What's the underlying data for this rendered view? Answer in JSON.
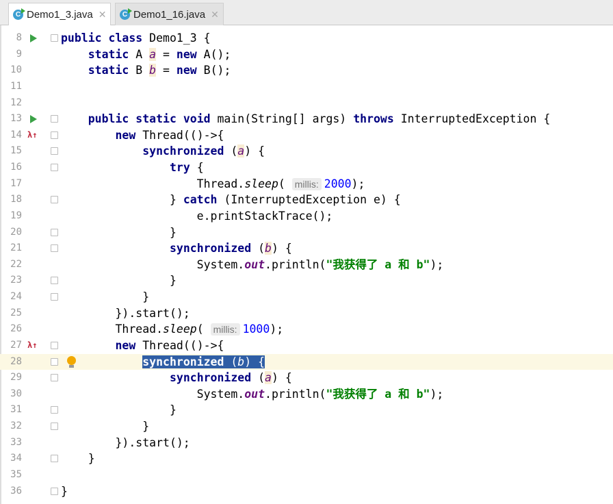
{
  "tabs": [
    {
      "label": "Demo1_3.java",
      "active": true
    },
    {
      "label": "Demo1_16.java",
      "active": false
    }
  ],
  "lines": [
    {
      "n": "8",
      "run": true,
      "fold": true,
      "tokens": [
        [
          "kw",
          "public class "
        ],
        [
          "",
          "Demo1_3 {"
        ]
      ]
    },
    {
      "n": "9",
      "tokens": [
        [
          "",
          "    "
        ],
        [
          "kw",
          "static "
        ],
        [
          "",
          "A "
        ],
        [
          "fld",
          "a"
        ],
        [
          "",
          " = "
        ],
        [
          "kw",
          "new "
        ],
        [
          "",
          "A();"
        ]
      ]
    },
    {
      "n": "10",
      "tokens": [
        [
          "",
          "    "
        ],
        [
          "kw",
          "static "
        ],
        [
          "",
          "B "
        ],
        [
          "fld",
          "b"
        ],
        [
          "",
          " = "
        ],
        [
          "kw",
          "new "
        ],
        [
          "",
          "B();"
        ]
      ]
    },
    {
      "n": "11",
      "tokens": []
    },
    {
      "n": "12",
      "tokens": []
    },
    {
      "n": "13",
      "run": true,
      "fold": true,
      "tokens": [
        [
          "",
          "    "
        ],
        [
          "kw",
          "public static void "
        ],
        [
          "",
          "main(String[] args) "
        ],
        [
          "kw",
          "throws "
        ],
        [
          "",
          "InterruptedException {"
        ]
      ]
    },
    {
      "n": "14",
      "lambda": true,
      "fold": true,
      "tokens": [
        [
          "",
          "        "
        ],
        [
          "kw",
          "new "
        ],
        [
          "",
          "Thread(()->{"
        ]
      ]
    },
    {
      "n": "15",
      "fold": true,
      "tokens": [
        [
          "",
          "            "
        ],
        [
          "kw",
          "synchronized "
        ],
        [
          "",
          "("
        ],
        [
          "fld",
          "a"
        ],
        [
          "",
          ") {"
        ]
      ]
    },
    {
      "n": "16",
      "fold": true,
      "tokens": [
        [
          "",
          "                "
        ],
        [
          "kw",
          "try "
        ],
        [
          "",
          "{"
        ]
      ]
    },
    {
      "n": "17",
      "tokens": [
        [
          "",
          "                    Thread."
        ],
        [
          "sm",
          "sleep"
        ],
        [
          "",
          "( "
        ],
        [
          "hint",
          "millis:"
        ],
        [
          "num",
          "2000"
        ],
        [
          "",
          ");"
        ]
      ]
    },
    {
      "n": "18",
      "fold": true,
      "tokens": [
        [
          "",
          "                } "
        ],
        [
          "kw",
          "catch "
        ],
        [
          "",
          "(InterruptedException e) {"
        ]
      ]
    },
    {
      "n": "19",
      "tokens": [
        [
          "",
          "                    e.printStackTrace();"
        ]
      ]
    },
    {
      "n": "20",
      "fold": true,
      "tokens": [
        [
          "",
          "                }"
        ]
      ]
    },
    {
      "n": "21",
      "fold": true,
      "tokens": [
        [
          "",
          "                "
        ],
        [
          "kw",
          "synchronized "
        ],
        [
          "",
          "("
        ],
        [
          "fld",
          "b"
        ],
        [
          "",
          ") {"
        ]
      ]
    },
    {
      "n": "22",
      "tokens": [
        [
          "",
          "                    System."
        ],
        [
          "sf",
          "out"
        ],
        [
          "",
          ".println("
        ],
        [
          "str",
          "\"我获得了 a 和 b\""
        ],
        [
          "",
          ");"
        ]
      ]
    },
    {
      "n": "23",
      "fold": true,
      "tokens": [
        [
          "",
          "                }"
        ]
      ]
    },
    {
      "n": "24",
      "fold": true,
      "tokens": [
        [
          "",
          "            }"
        ]
      ]
    },
    {
      "n": "25",
      "tokens": [
        [
          "",
          "        }).start();"
        ]
      ]
    },
    {
      "n": "26",
      "tokens": [
        [
          "",
          "        Thread."
        ],
        [
          "sm",
          "sleep"
        ],
        [
          "",
          "( "
        ],
        [
          "hint",
          "millis:"
        ],
        [
          "num",
          "1000"
        ],
        [
          "",
          ");"
        ]
      ]
    },
    {
      "n": "27",
      "lambda": true,
      "fold": true,
      "tokens": [
        [
          "",
          "        "
        ],
        [
          "kw",
          "new "
        ],
        [
          "",
          "Thread(()->{"
        ]
      ]
    },
    {
      "n": "28",
      "current": true,
      "bulb": true,
      "fold": true,
      "tokens": [
        [
          "",
          "            "
        ],
        [
          "sel kw",
          "synchronized "
        ],
        [
          "sel",
          "("
        ],
        [
          "sel fld",
          "b"
        ],
        [
          "sel",
          ") {"
        ]
      ]
    },
    {
      "n": "29",
      "fold": true,
      "tokens": [
        [
          "",
          "                "
        ],
        [
          "kw",
          "synchronized "
        ],
        [
          "",
          "("
        ],
        [
          "fld",
          "a"
        ],
        [
          "",
          ") {"
        ]
      ]
    },
    {
      "n": "30",
      "tokens": [
        [
          "",
          "                    System."
        ],
        [
          "sf",
          "out"
        ],
        [
          "",
          ".println("
        ],
        [
          "str",
          "\"我获得了 a 和 b\""
        ],
        [
          "",
          ");"
        ]
      ]
    },
    {
      "n": "31",
      "fold": true,
      "tokens": [
        [
          "",
          "                }"
        ]
      ]
    },
    {
      "n": "32",
      "fold": true,
      "tokens": [
        [
          "",
          "            }"
        ]
      ]
    },
    {
      "n": "33",
      "tokens": [
        [
          "",
          "        }).start();"
        ]
      ]
    },
    {
      "n": "34",
      "fold": true,
      "tokens": [
        [
          "",
          "    }"
        ]
      ]
    },
    {
      "n": "35",
      "tokens": []
    },
    {
      "n": "36",
      "fold": true,
      "tokens": [
        [
          "",
          "}"
        ]
      ]
    }
  ]
}
